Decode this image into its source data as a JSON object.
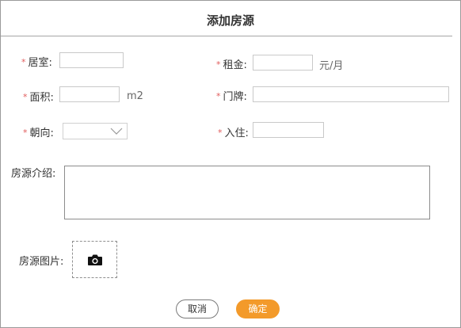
{
  "dialog": {
    "title": "添加房源"
  },
  "form": {
    "bedroom": {
      "label": "居室:",
      "value": "",
      "required_mark": "*"
    },
    "rent": {
      "label": "租金:",
      "value": "",
      "unit": "元/月",
      "required_mark": "*"
    },
    "area": {
      "label": "面积:",
      "value": "",
      "unit": "m2",
      "required_mark": "*"
    },
    "door_number": {
      "label": "门牌:",
      "value": "",
      "required_mark": "*"
    },
    "orientation": {
      "label": "朝向:",
      "selected": "",
      "required_mark": "*"
    },
    "move_in": {
      "label": "入住:",
      "value": "",
      "required_mark": "*"
    },
    "description": {
      "label": "房源介绍:",
      "value": ""
    },
    "photos": {
      "label": "房源图片:"
    }
  },
  "actions": {
    "cancel_label": "取消",
    "confirm_label": "确定"
  },
  "colors": {
    "required": "#e15b5b",
    "primary": "#f39a2a"
  },
  "icons": {
    "upload": "camera-icon",
    "select": "chevron-down-icon"
  }
}
